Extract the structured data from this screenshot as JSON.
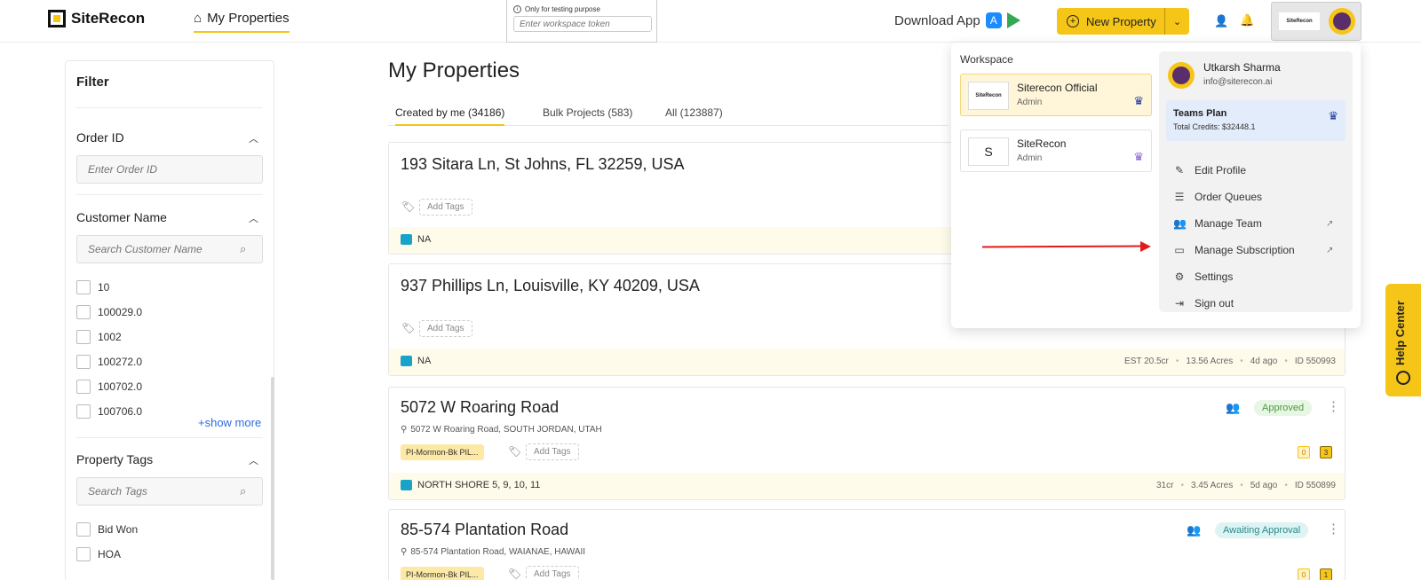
{
  "app": {
    "brand": "SiteRecon",
    "nav_tab": "My Properties",
    "token_note": "Only for testing purpose",
    "token_placeholder": "Enter workspace token",
    "download_label": "Download App",
    "new_property_label": "New Property",
    "account_logo_text": "SiteRecon",
    "accent_color": "#f5c518"
  },
  "filter": {
    "title": "Filter",
    "order_id": {
      "title": "Order ID",
      "placeholder": "Enter Order ID"
    },
    "customer": {
      "title": "Customer Name",
      "placeholder": "Search Customer Name",
      "options": [
        "10",
        "100029.0",
        "1002",
        "100272.0",
        "100702.0",
        "100706.0"
      ],
      "show_more": "+show more"
    },
    "tags": {
      "title": "Property Tags",
      "placeholder": "Search Tags",
      "options": [
        "Bid Won",
        "HOA"
      ]
    }
  },
  "main": {
    "title": "My Properties",
    "tabs": [
      {
        "label": "Created by me (34186)"
      },
      {
        "label": "Bulk Projects (583)"
      },
      {
        "label": "All (123887)"
      }
    ],
    "cards": [
      {
        "title": "193 Sitara Ln, St Johns, FL 32259, USA",
        "add_tags": "Add Tags",
        "footer": "NA"
      },
      {
        "title": "937 Phillips Ln, Louisville, KY 40209, USA",
        "add_tags": "Add Tags",
        "footer": "NA",
        "meta": [
          "EST 20.5cr",
          "13.56 Acres",
          "4d ago",
          "ID 550993"
        ]
      },
      {
        "title": "5072 W Roaring Road",
        "address": "5072 W Roaring Road, SOUTH JORDAN, UTAH",
        "tag": "PI-Mormon-Bk PIL...",
        "add_tags": "Add Tags",
        "status": "Approved",
        "counts": [
          "0",
          "3"
        ],
        "footer": "NORTH SHORE 5, 9, 10, 11",
        "meta": [
          "31cr",
          "3.45 Acres",
          "5d ago",
          "ID 550899"
        ]
      },
      {
        "title": "85-574 Plantation Road",
        "address": "85-574 Plantation Road, WAIANAE, HAWAII",
        "tag": "PI-Mormon-Bk PIL...",
        "add_tags": "Add Tags",
        "status": "Awaiting Approval",
        "counts": [
          "0",
          "1"
        ]
      }
    ]
  },
  "dropdown": {
    "workspace_title": "Workspace",
    "workspaces": [
      {
        "name": "Siterecon Official",
        "role": "Admin",
        "logo_text": "SiteRecon"
      },
      {
        "name": "SiteRecon",
        "role": "Admin",
        "letter": "S"
      }
    ],
    "user": {
      "name": "Utkarsh Sharma",
      "email": "info@siterecon.ai"
    },
    "plan": {
      "name": "Teams Plan",
      "credits": "Total Credits: $32448.1"
    },
    "menu": [
      {
        "label": "Edit Profile",
        "icon": "edit-icon"
      },
      {
        "label": "Order Queues",
        "icon": "queue-icon"
      },
      {
        "label": "Manage Team",
        "icon": "team-icon",
        "external": true
      },
      {
        "label": "Manage Subscription",
        "icon": "card-icon",
        "external": true
      },
      {
        "label": "Settings",
        "icon": "gear-icon"
      },
      {
        "label": "Sign out",
        "icon": "signout-icon"
      }
    ]
  },
  "help": {
    "label": "Help Center"
  }
}
